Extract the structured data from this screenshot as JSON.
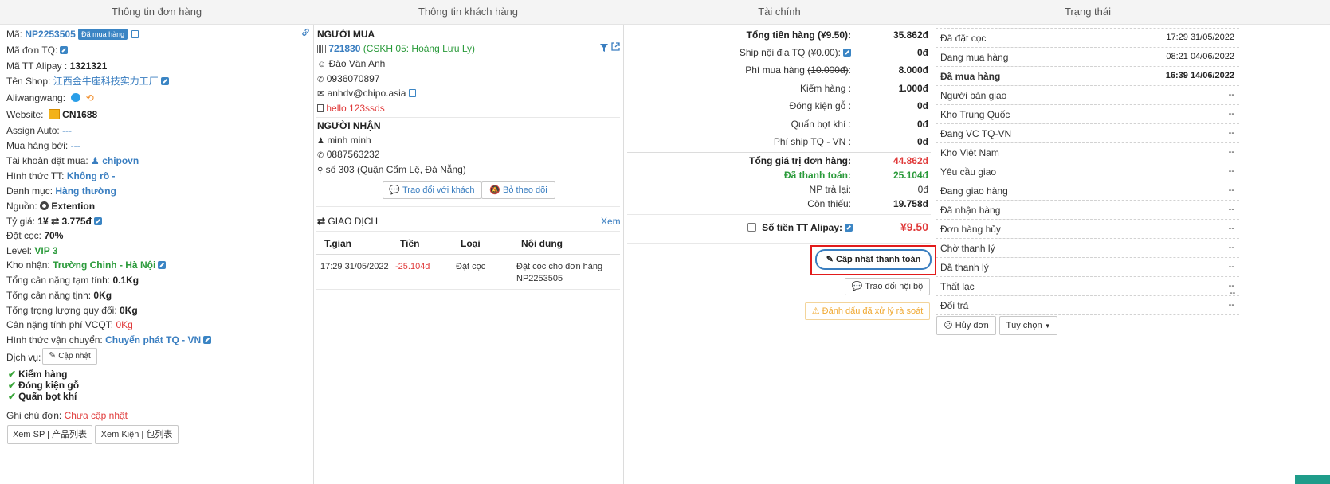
{
  "headers": {
    "order": "Thông tin đơn hàng",
    "customer": "Thông tin khách hàng",
    "finance": "Tài chính",
    "status": "Trạng thái"
  },
  "order": {
    "code_label": "Mã:",
    "code": "NP2253505",
    "code_badge": "Đã mua hàng",
    "tq_code_label": "Mã đơn TQ:",
    "alipay_label": "Mã TT Alipay :",
    "alipay_value": "1321321",
    "shop_label": "Tên Shop:",
    "shop_value": "江西金牛座科技实力工厂",
    "aliwangwang_label": "Aliwangwang:",
    "website_label": "Website:",
    "website_value": "CN1688",
    "assign_label": "Assign Auto:",
    "assign_value": "---",
    "buyer_label": "Mua hàng bởi:",
    "buyer_value": "---",
    "account_label": "Tài khoản đặt mua:",
    "account_value": "chipovn",
    "payment_label": "Hình thức TT:",
    "payment_value": "Không rõ -",
    "category_label": "Danh mục:",
    "category_value": "Hàng thường",
    "source_label": "Nguồn:",
    "source_value": "Extention",
    "rate_label": "Tỷ giá:",
    "rate_left": "1¥",
    "rate_right": "3.775đ",
    "deposit_label": "Đặt cọc:",
    "deposit_value": "70%",
    "level_label": "Level:",
    "level_value": "VIP 3",
    "warehouse_label": "Kho nhận:",
    "warehouse_value": "Trường Chinh - Hà Nội",
    "est_weight_label": "Tổng cân nặng tạm tính:",
    "est_weight_value": "0.1Kg",
    "net_weight_label": "Tổng cân nặng tịnh:",
    "net_weight_value": "0Kg",
    "conv_weight_label": "Tổng trọng lượng quy đổi:",
    "conv_weight_value": "0Kg",
    "fee_weight_label": "Cân nặng tính phí VCQT:",
    "fee_weight_value": "0Kg",
    "shipping_label": "Hình thức vận chuyển:",
    "shipping_value": "Chuyển phát TQ - VN",
    "service_label": "Dịch vụ:",
    "update_btn": "Cập nhật",
    "services": [
      "Kiểm hàng",
      "Đóng kiện gỗ",
      "Quấn bọt khí"
    ],
    "note_label": "Ghi chú đơn:",
    "note_value": "Chưa cập nhật",
    "view_products_btn": "Xem SP | 产品列表",
    "view_packages_btn": "Xem Kiện | 包列表"
  },
  "customer": {
    "buyer_title": "NGƯỜI MUA",
    "buyer_id": "721830",
    "buyer_cskh": "(CSKH 05: Hoàng Lưu Ly)",
    "buyer_name": "Đào Văn Anh",
    "buyer_phone": "0936070897",
    "buyer_email": "anhdv@chipo.asia",
    "buyer_note": "hello 123ssds",
    "receiver_title": "NGƯỜI NHẬN",
    "receiver_name": "minh minh",
    "receiver_phone": "0887563232",
    "receiver_address": "số 303 (Quận Cẩm Lệ, Đà Nẵng)",
    "chat_btn": "Trao đổi với khách",
    "unfollow_btn": "Bỏ theo dõi",
    "tx_title": "GIAO DỊCH",
    "tx_view": "Xem",
    "tx_headers": [
      "T.gian",
      "Tiền",
      "Loại",
      "Nội dung"
    ],
    "tx_rows": [
      {
        "time": "17:29 31/05/2022",
        "amount": "-25.104đ",
        "type": "Đặt cọc",
        "content_1": "Đặt cọc cho đơn hàng",
        "content_2": "NP2253505"
      }
    ]
  },
  "finance": {
    "rows": [
      {
        "label": "Tổng tiền hàng (¥9.50):",
        "value": "35.862đ"
      },
      {
        "label": "Ship nội địa TQ (¥0.00):",
        "value": "0đ"
      },
      {
        "label": "Phí mua hàng",
        "strike": "(10.000đ)",
        "label_suffix": ":",
        "value": "8.000đ"
      },
      {
        "label": "Kiểm hàng :",
        "value": "1.000đ"
      },
      {
        "label": "Đóng kiện gỗ :",
        "value": "0đ"
      },
      {
        "label": "Quấn bọt khí :",
        "value": "0đ"
      },
      {
        "label": "Phí ship TQ - VN :",
        "value": "0đ"
      }
    ],
    "total_label": "Tổng giá trị đơn hàng:",
    "total_value": "44.862đ",
    "paid_label": "Đã thanh toán:",
    "paid_value": "25.104đ",
    "refund_label": "NP trả lại:",
    "refund_value": "0đ",
    "remaining_label": "Còn thiếu:",
    "remaining_value": "19.758đ",
    "alipay_label": "Số tiền TT Alipay:",
    "alipay_value": "¥9.50",
    "update_payment_btn": "Cập nhật thanh toán",
    "internal_chat_btn": "Trao đổi nội bộ",
    "mark_btn": "Đánh dấu đã xử lý rà soát"
  },
  "status": {
    "rows": [
      {
        "label": "Đã đặt cọc",
        "value": "17:29 31/05/2022"
      },
      {
        "label": "Đang mua hàng",
        "value": "08:21 04/06/2022"
      },
      {
        "label": "Đã mua hàng",
        "value": "16:39 14/06/2022",
        "active": true
      },
      {
        "label": "Người bán giao",
        "value": "--"
      },
      {
        "label": "Kho Trung Quốc",
        "value": "--"
      },
      {
        "label": "Đang VC TQ-VN",
        "value": "--"
      },
      {
        "label": "Kho Việt Nam",
        "value": "--"
      },
      {
        "label": "Yêu cầu giao",
        "value": "--"
      },
      {
        "label": "Đang giao hàng",
        "value": "--"
      },
      {
        "label": "Đã nhận hàng",
        "value": "--"
      },
      {
        "label": "Đơn hàng hủy",
        "value": "--"
      },
      {
        "label": "Chờ thanh lý",
        "value": "--"
      },
      {
        "label": "Đã thanh lý",
        "value": "--"
      },
      {
        "label": "Thất lạc",
        "value": "--"
      },
      {
        "label": "Đổi trả",
        "value": "--"
      }
    ],
    "extra_dash": "--",
    "cancel_btn": "Hủy đơn",
    "options_btn": "Tùy chọn"
  },
  "colors": {
    "blue": "#3a7ec0",
    "green": "#2a9a3a",
    "red": "#e03a3a",
    "highlight": "#e21b1b"
  }
}
